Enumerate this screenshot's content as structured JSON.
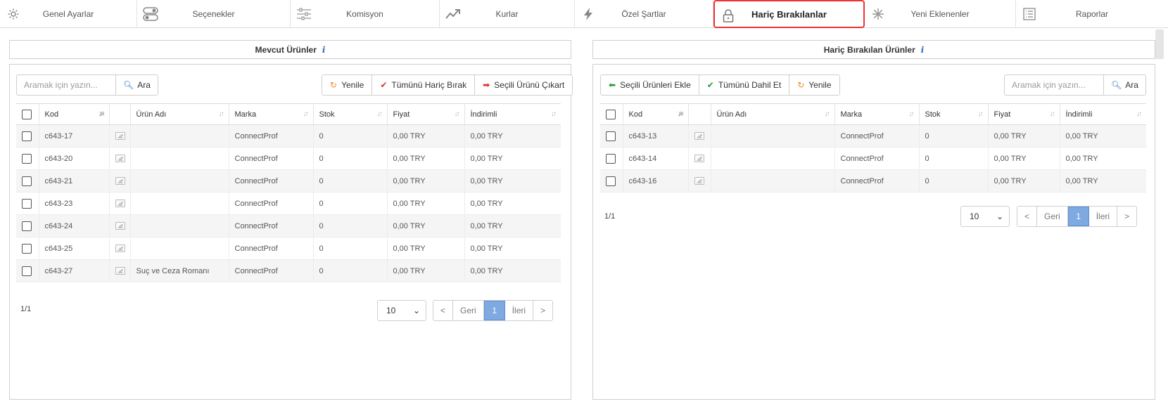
{
  "tabs": [
    {
      "label": "Genel Ayarlar",
      "icon": "gear-icon"
    },
    {
      "label": "Seçenekler",
      "icon": "toggle-icon"
    },
    {
      "label": "Komisyon",
      "icon": "sliders-icon"
    },
    {
      "label": "Kurlar",
      "icon": "trend-up-icon"
    },
    {
      "label": "Özel Şartlar",
      "icon": "lightning-icon"
    },
    {
      "label": "Hariç Bırakılanlar",
      "icon": "lock-icon",
      "active": true
    },
    {
      "label": "Yeni Eklenenler",
      "icon": "snowflake-icon"
    },
    {
      "label": "Raporlar",
      "icon": "list-icon"
    }
  ],
  "left": {
    "title": "Mevcut Ürünler",
    "search_placeholder": "Aramak için yazın...",
    "search_button": "Ara",
    "buttons": [
      "Yenile",
      "Tümünü Hariç Bırak",
      "Seçili Ürünü Çıkart"
    ],
    "columns": [
      "Kod",
      "Ürün Adı",
      "Marka",
      "Stok",
      "Fiyat",
      "İndirimli"
    ],
    "rows": [
      [
        "c643-17",
        "",
        "ConnectProf",
        "0",
        "0,00 TRY",
        "0,00 TRY"
      ],
      [
        "c643-20",
        "",
        "ConnectProf",
        "0",
        "0,00 TRY",
        "0,00 TRY"
      ],
      [
        "c643-21",
        "",
        "ConnectProf",
        "0",
        "0,00 TRY",
        "0,00 TRY"
      ],
      [
        "c643-23",
        "",
        "ConnectProf",
        "0",
        "0,00 TRY",
        "0,00 TRY"
      ],
      [
        "c643-24",
        "",
        "ConnectProf",
        "0",
        "0,00 TRY",
        "0,00 TRY"
      ],
      [
        "c643-25",
        "",
        "ConnectProf",
        "0",
        "0,00 TRY",
        "0,00 TRY"
      ],
      [
        "c643-27",
        "Suç ve Ceza Romanı",
        "ConnectProf",
        "0",
        "0,00 TRY",
        "0,00 TRY"
      ]
    ],
    "page_info": "1/1",
    "page_size": "10",
    "pager": [
      "<",
      "Geri",
      "1",
      "İleri",
      ">"
    ]
  },
  "right": {
    "title": "Hariç Bırakılan Ürünler",
    "search_placeholder": "Aramak için yazın...",
    "search_button": "Ara",
    "buttons": [
      "Seçili Ürünleri Ekle",
      "Tümünü Dahil Et",
      "Yenile"
    ],
    "columns": [
      "Kod",
      "Ürün Adı",
      "Marka",
      "Stok",
      "Fiyat",
      "İndirimli"
    ],
    "rows": [
      [
        "c643-13",
        "",
        "ConnectProf",
        "0",
        "0,00 TRY",
        "0,00 TRY"
      ],
      [
        "c643-14",
        "",
        "ConnectProf",
        "0",
        "0,00 TRY",
        "0,00 TRY"
      ],
      [
        "c643-16",
        "",
        "ConnectProf",
        "0",
        "0,00 TRY",
        "0,00 TRY"
      ]
    ],
    "page_info": "1/1",
    "page_size": "10",
    "pager": [
      "<",
      "Geri",
      "1",
      "İleri",
      ">"
    ]
  }
}
